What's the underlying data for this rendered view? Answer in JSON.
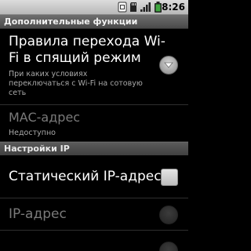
{
  "status_bar": {
    "time": "8:26",
    "icons": [
      "usb-debug-icon",
      "sd-card-icon",
      "signal-icon",
      "battery-icon"
    ]
  },
  "title_bar": {
    "title": "Дополнительные функции"
  },
  "preferences": {
    "wifi_sleep": {
      "title_line1": "Правила перехода Wi-",
      "title_line2": "Fi в спящий режим",
      "summary_line1": "При каких условиях",
      "summary_line2": "переключаться с Wi-Fi на сотовую",
      "summary_line3": "сеть"
    },
    "mac_address": {
      "title": "MAC-адрес",
      "summary": "Недоступно"
    }
  },
  "section": {
    "ip_settings": "Настройки IP"
  },
  "ip_preferences": {
    "static_ip": {
      "title": "Статический IP-адрес",
      "checked": false
    },
    "ip_address": {
      "title": "IP-адрес",
      "enabled": false
    }
  },
  "colors": {
    "background": "#000000",
    "status_bar": "#c8c8c8",
    "title_bar": "#5a5a5a",
    "primary_text": "#ffffff",
    "secondary_text": "#a9a9a9",
    "disabled_text": "#7a7a7a"
  }
}
